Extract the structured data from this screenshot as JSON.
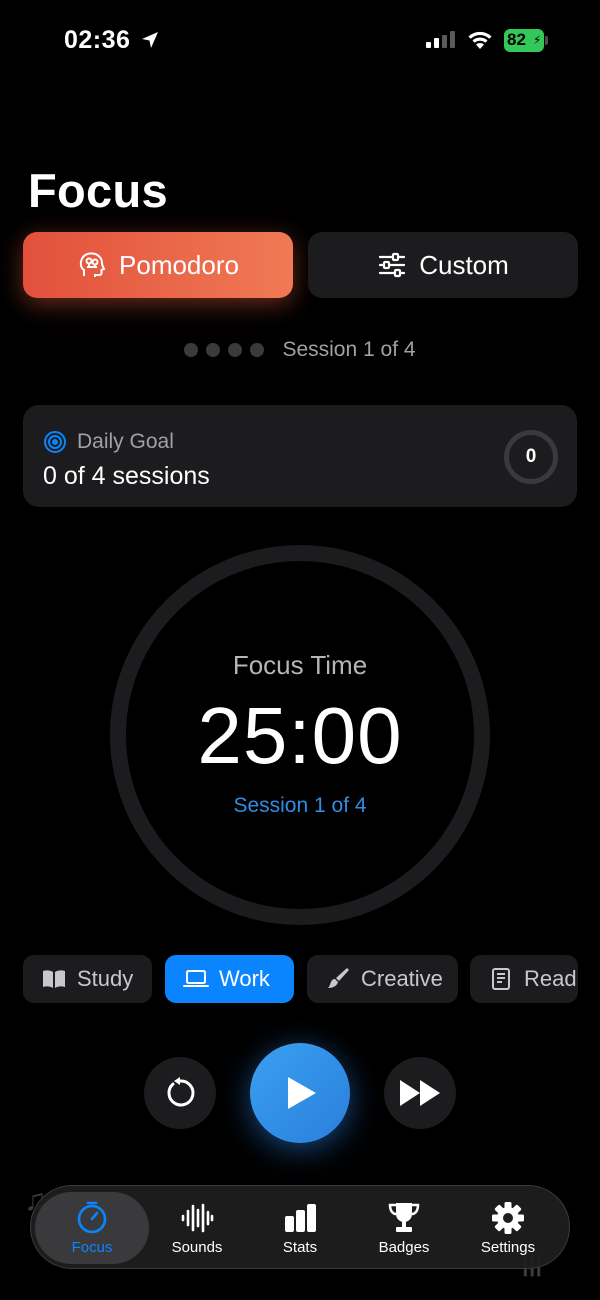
{
  "status_bar": {
    "time": "02:36",
    "battery": "82"
  },
  "page": {
    "title": "Focus"
  },
  "modes": {
    "pomodoro_label": "Pomodoro",
    "custom_label": "Custom",
    "selected": "Pomodoro"
  },
  "session_progress": {
    "text": "Session 1 of 4",
    "completed": 0,
    "total": 4
  },
  "daily_goal": {
    "label": "Daily Goal",
    "value": "0 of 4 sessions",
    "count": "0"
  },
  "timer": {
    "label": "Focus Time",
    "value": "25:00",
    "session": "Session 1 of 4"
  },
  "categories": {
    "items": [
      {
        "label": "Study",
        "icon": "book-icon"
      },
      {
        "label": "Work",
        "icon": "laptop-icon"
      },
      {
        "label": "Creative",
        "icon": "paintbrush-icon"
      },
      {
        "label": "Readin",
        "icon": "reading-book-icon"
      }
    ],
    "selected": "Work"
  },
  "controls": {
    "reset": "reset-icon",
    "play": "play-icon",
    "skip": "skip-forward-icon"
  },
  "tabs": [
    {
      "label": "Focus",
      "icon": "timer-icon",
      "active": true
    },
    {
      "label": "Sounds",
      "icon": "waveform-icon"
    },
    {
      "label": "Stats",
      "icon": "bar-chart-icon"
    },
    {
      "label": "Badges",
      "icon": "trophy-icon"
    },
    {
      "label": "Settings",
      "icon": "gear-icon"
    }
  ],
  "colors": {
    "accent": "#0a84ff",
    "pomodoro": "#e8603f",
    "battery": "#34c759",
    "card": "#1c1c1e"
  }
}
